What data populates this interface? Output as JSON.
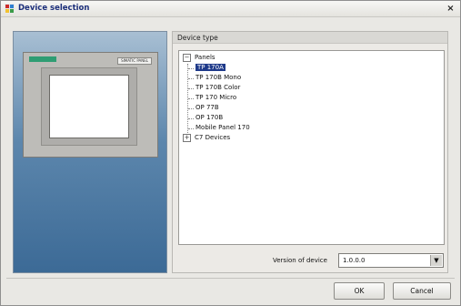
{
  "window": {
    "title": "Device selection",
    "close_glyph": "×"
  },
  "preview": {
    "brand_text": "SIMATIC PANEL"
  },
  "device_type": {
    "header": "Device type",
    "tree": [
      {
        "label": "Panels",
        "expanded": true,
        "children": [
          {
            "label": "TP 170A",
            "selected": true
          },
          {
            "label": "TP 170B Mono"
          },
          {
            "label": "TP 170B Color"
          },
          {
            "label": "TP 170 Micro"
          },
          {
            "label": "OP 77B"
          },
          {
            "label": "OP 170B"
          },
          {
            "label": "Mobile Panel 170"
          }
        ]
      },
      {
        "label": "C7 Devices",
        "expanded": false
      }
    ]
  },
  "version": {
    "label": "Version of device",
    "value": "1.0.0.0",
    "dropdown_icon": "▼"
  },
  "buttons": {
    "ok": "OK",
    "cancel": "Cancel"
  },
  "colors": {
    "selection": "#1f3a8a",
    "title_text": "#1c2f7a",
    "panel_gradient_top": "#a8bfd3",
    "panel_gradient_bottom": "#3c6a96"
  }
}
